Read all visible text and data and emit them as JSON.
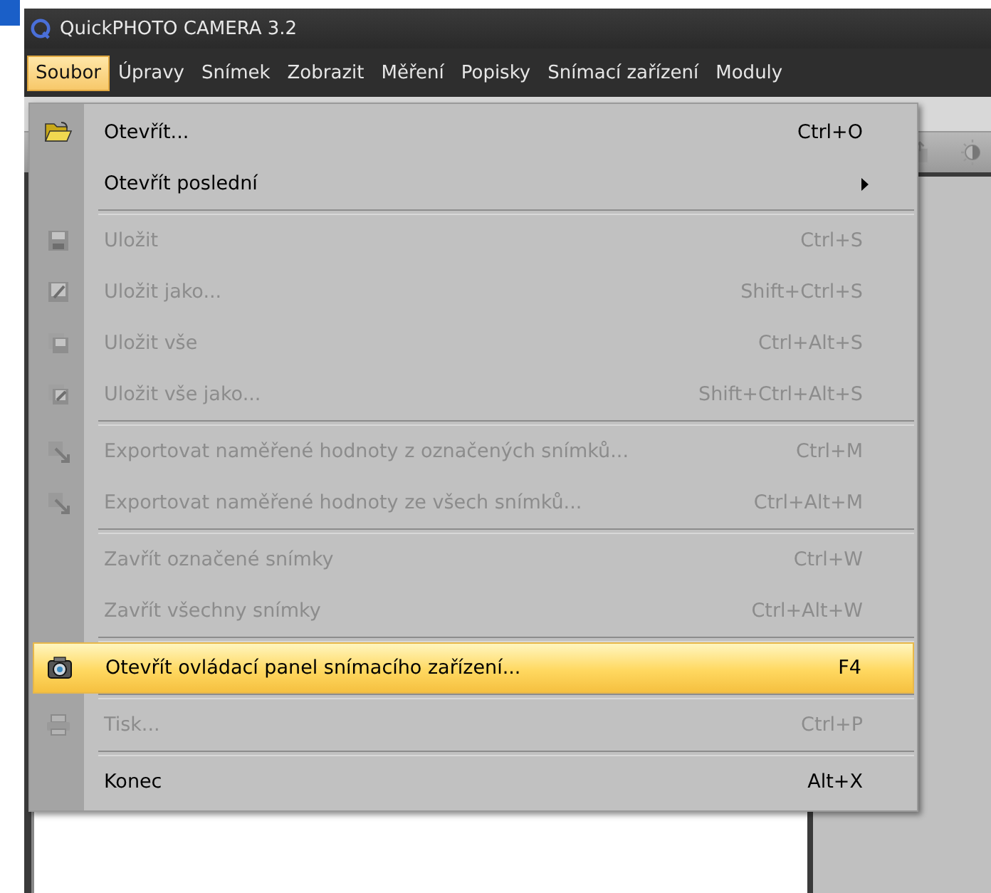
{
  "window": {
    "title": "QuickPHOTO CAMERA 3.2"
  },
  "menubar": [
    {
      "label": "Soubor",
      "selected": true
    },
    {
      "label": "Úpravy",
      "selected": false
    },
    {
      "label": "Snímek",
      "selected": false
    },
    {
      "label": "Zobrazit",
      "selected": false
    },
    {
      "label": "Měření",
      "selected": false
    },
    {
      "label": "Popisky",
      "selected": false
    },
    {
      "label": "Snímací zařízení",
      "selected": false
    },
    {
      "label": "Moduly",
      "selected": false
    }
  ],
  "menu": [
    {
      "kind": "item",
      "label": "Otevřít...",
      "shortcut": "Ctrl+O",
      "disabled": false,
      "selected": false
    },
    {
      "kind": "item",
      "label": "Otevřít poslední",
      "submenu": true,
      "disabled": false,
      "selected": false
    },
    {
      "kind": "separator"
    },
    {
      "kind": "item",
      "label": "Uložit",
      "shortcut": "Ctrl+S",
      "disabled": true,
      "selected": false
    },
    {
      "kind": "item",
      "label": "Uložit jako...",
      "shortcut": "Shift+Ctrl+S",
      "disabled": true,
      "selected": false
    },
    {
      "kind": "item",
      "label": "Uložit vše",
      "shortcut": "Ctrl+Alt+S",
      "disabled": true,
      "selected": false
    },
    {
      "kind": "item",
      "label": "Uložit vše jako...",
      "shortcut": "Shift+Ctrl+Alt+S",
      "disabled": true,
      "selected": false
    },
    {
      "kind": "separator"
    },
    {
      "kind": "item",
      "label": "Exportovat naměřené hodnoty z označených snímků...",
      "shortcut": "Ctrl+M",
      "disabled": true,
      "selected": false
    },
    {
      "kind": "item",
      "label": "Exportovat naměřené hodnoty ze všech snímků...",
      "shortcut": "Ctrl+Alt+M",
      "disabled": true,
      "selected": false
    },
    {
      "kind": "separator"
    },
    {
      "kind": "item",
      "label": "Zavřít označené snímky",
      "shortcut": "Ctrl+W",
      "disabled": true,
      "selected": false
    },
    {
      "kind": "item",
      "label": "Zavřít všechny snímky",
      "shortcut": "Ctrl+Alt+W",
      "disabled": true,
      "selected": false
    },
    {
      "kind": "separator"
    },
    {
      "kind": "item",
      "label": "Otevřít ovládací panel snímacího zařízení...",
      "shortcut": "F4",
      "disabled": false,
      "selected": true
    },
    {
      "kind": "separator"
    },
    {
      "kind": "item",
      "label": "Tisk...",
      "shortcut": "Ctrl+P",
      "disabled": true,
      "selected": false
    },
    {
      "kind": "separator"
    },
    {
      "kind": "item",
      "label": "Konec",
      "shortcut": "Alt+X",
      "disabled": false,
      "selected": false
    }
  ]
}
